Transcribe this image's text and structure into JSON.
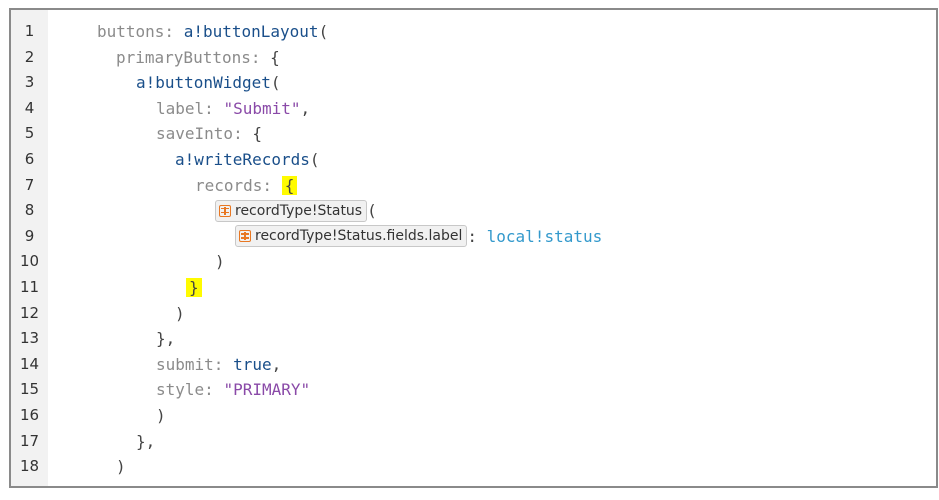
{
  "editor": {
    "line_numbers": [
      "1",
      "2",
      "3",
      "4",
      "5",
      "6",
      "7",
      "8",
      "9",
      "10",
      "11",
      "12",
      "13",
      "14",
      "15",
      "16",
      "17",
      "18"
    ],
    "lines": [
      {
        "k": "buttons: ",
        "f": "a!buttonLayout",
        "p": "("
      },
      {
        "k": "primaryButtons: ",
        "p": "{"
      },
      {
        "f": "a!buttonWidget",
        "p": "("
      },
      {
        "k": "label: ",
        "s": "\"Submit\"",
        "p": ","
      },
      {
        "k": "saveInto: ",
        "p": "{"
      },
      {
        "f": "a!writeRecords",
        "p": "("
      },
      {
        "k": "records: ",
        "hl": "{"
      },
      {
        "chip": "recordType!Status",
        "p": "("
      },
      {
        "chip": "recordType!Status.fields.label",
        "p": ": ",
        "v": "local!status"
      },
      {
        "p": ")"
      },
      {
        "hl": "}"
      },
      {
        "p": ")"
      },
      {
        "p": "},"
      },
      {
        "k": "submit: ",
        "kw": "true",
        "p": ","
      },
      {
        "k": "style: ",
        "s": "\"PRIMARY\""
      },
      {
        "p": ")"
      },
      {
        "p": "},"
      },
      {
        "p": ")"
      }
    ]
  },
  "icons": {
    "record_type": "record-type-icon"
  },
  "colors": {
    "highlight": "#fffb00",
    "record_icon": "#e87722",
    "variable": "#3399cc",
    "string": "#8a4aa8",
    "function": "#1a4f8a"
  }
}
